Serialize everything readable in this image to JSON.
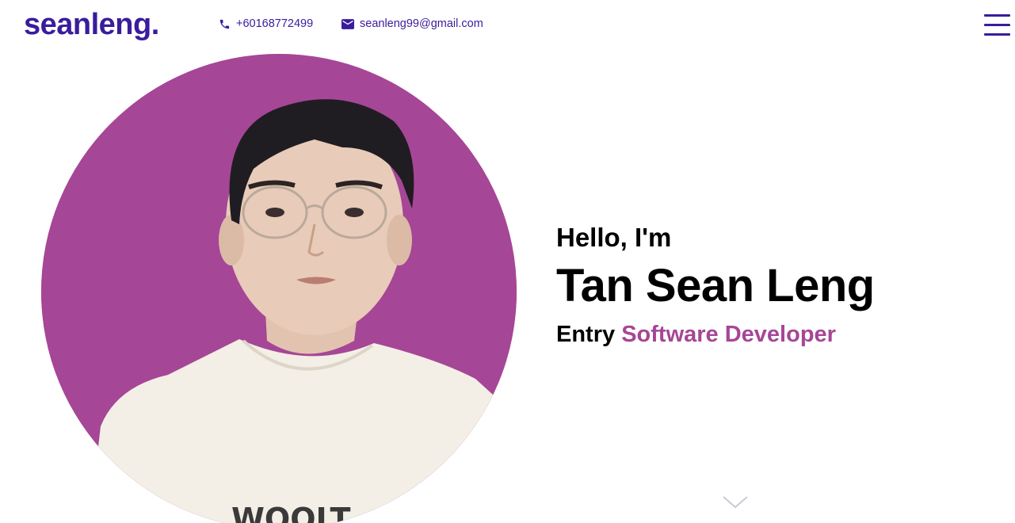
{
  "header": {
    "logo": "seanleng.",
    "phone": "+60168772499",
    "email": "seanleng99@gmail.com",
    "menu_icon": "hamburger-icon"
  },
  "hero": {
    "greeting": "Hello, I'm",
    "name": "Tan Sean Leng",
    "role_prefix": "Entry",
    "role_highlight": "Software Developer",
    "photo_alt": "portrait of Tan Sean Leng"
  },
  "colors": {
    "brand": "#3a1c9c",
    "accent": "#a64696",
    "text": "#000000",
    "background": "#ffffff"
  },
  "icons": {
    "phone": "phone-icon",
    "email": "envelope-icon",
    "scroll": "chevron-down-icon"
  }
}
